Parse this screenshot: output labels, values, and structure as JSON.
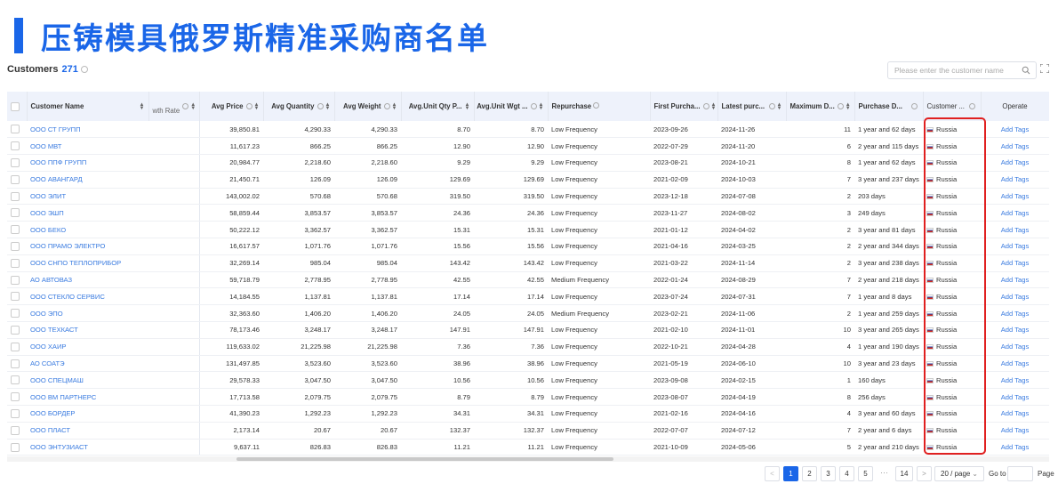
{
  "banner": {
    "title": "压铸模具俄罗斯精准采购商名单"
  },
  "customers": {
    "label": "Customers",
    "count": "271"
  },
  "search": {
    "placeholder": "Please enter the customer name"
  },
  "columns": {
    "name": "Customer Name",
    "growth": "wth Rate",
    "avg_price": "Avg Price",
    "avg_qty": "Avg Quantity",
    "avg_weight": "Avg Weight",
    "unit_qty": "Avg.Unit Qty P...",
    "unit_wgt": "Avg.Unit Wgt ...",
    "repurchase": "Repurchase",
    "first": "First Purcha...",
    "latest": "Latest purc...",
    "max": "Maximum D...",
    "duration": "Purchase D...",
    "country": "Customer ...",
    "operate": "Operate"
  },
  "rows": [
    {
      "name": "ООО СТ ГРУПП",
      "price": "39,850.81",
      "qty": "4,290.33",
      "weight": "4,290.33",
      "uqty": "8.70",
      "uwgt": "8.70",
      "rep": "Low Frequency",
      "first": "2023-09-26",
      "latest": "2024-11-26",
      "max": "11",
      "dur": "1 year and 62 days",
      "country": "Russia",
      "op": "Add Tags"
    },
    {
      "name": "ООО МВТ",
      "price": "11,617.23",
      "qty": "866.25",
      "weight": "866.25",
      "uqty": "12.90",
      "uwgt": "12.90",
      "rep": "Low Frequency",
      "first": "2022-07-29",
      "latest": "2024-11-20",
      "max": "6",
      "dur": "2 year and 115 days",
      "country": "Russia",
      "op": "Add Tags"
    },
    {
      "name": "ООО ППФ ГРУПП",
      "price": "20,984.77",
      "qty": "2,218.60",
      "weight": "2,218.60",
      "uqty": "9.29",
      "uwgt": "9.29",
      "rep": "Low Frequency",
      "first": "2023-08-21",
      "latest": "2024-10-21",
      "max": "8",
      "dur": "1 year and 62 days",
      "country": "Russia",
      "op": "Add Tags"
    },
    {
      "name": "ООО АВАНГАРД",
      "price": "21,450.71",
      "qty": "126.09",
      "weight": "126.09",
      "uqty": "129.69",
      "uwgt": "129.69",
      "rep": "Low Frequency",
      "first": "2021-02-09",
      "latest": "2024-10-03",
      "max": "7",
      "dur": "3 year and 237 days",
      "country": "Russia",
      "op": "Add Tags"
    },
    {
      "name": "ООО ЭЛИТ",
      "price": "143,002.02",
      "qty": "570.68",
      "weight": "570.68",
      "uqty": "319.50",
      "uwgt": "319.50",
      "rep": "Low Frequency",
      "first": "2023-12-18",
      "latest": "2024-07-08",
      "max": "2",
      "dur": "203 days",
      "country": "Russia",
      "op": "Add Tags"
    },
    {
      "name": "ООО ЭШП",
      "price": "58,859.44",
      "qty": "3,853.57",
      "weight": "3,853.57",
      "uqty": "24.36",
      "uwgt": "24.36",
      "rep": "Low Frequency",
      "first": "2023-11-27",
      "latest": "2024-08-02",
      "max": "3",
      "dur": "249 days",
      "country": "Russia",
      "op": "Add Tags"
    },
    {
      "name": "ООО БЕКО",
      "price": "50,222.12",
      "qty": "3,362.57",
      "weight": "3,362.57",
      "uqty": "15.31",
      "uwgt": "15.31",
      "rep": "Low Frequency",
      "first": "2021-01-12",
      "latest": "2024-04-02",
      "max": "2",
      "dur": "3 year and 81 days",
      "country": "Russia",
      "op": "Add Tags"
    },
    {
      "name": "ООО ПРАМО ЭЛЕКТРО",
      "price": "16,617.57",
      "qty": "1,071.76",
      "weight": "1,071.76",
      "uqty": "15.56",
      "uwgt": "15.56",
      "rep": "Low Frequency",
      "first": "2021-04-16",
      "latest": "2024-03-25",
      "max": "2",
      "dur": "2 year and 344 days",
      "country": "Russia",
      "op": "Add Tags"
    },
    {
      "name": "ООО СНПО ТЕПЛОПРИБОР",
      "price": "32,269.14",
      "qty": "985.04",
      "weight": "985.04",
      "uqty": "143.42",
      "uwgt": "143.42",
      "rep": "Low Frequency",
      "first": "2021-03-22",
      "latest": "2024-11-14",
      "max": "2",
      "dur": "3 year and 238 days",
      "country": "Russia",
      "op": "Add Tags"
    },
    {
      "name": "АО АВТОВАЗ",
      "price": "59,718.79",
      "qty": "2,778.95",
      "weight": "2,778.95",
      "uqty": "42.55",
      "uwgt": "42.55",
      "rep": "Medium Frequency",
      "first": "2022-01-24",
      "latest": "2024-08-29",
      "max": "7",
      "dur": "2 year and 218 days",
      "country": "Russia",
      "op": "Add Tags"
    },
    {
      "name": "ООО СТЕКЛО СЕРВИС",
      "price": "14,184.55",
      "qty": "1,137.81",
      "weight": "1,137.81",
      "uqty": "17.14",
      "uwgt": "17.14",
      "rep": "Low Frequency",
      "first": "2023-07-24",
      "latest": "2024-07-31",
      "max": "7",
      "dur": "1 year and 8 days",
      "country": "Russia",
      "op": "Add Tags"
    },
    {
      "name": "ООО ЭПО",
      "price": "32,363.60",
      "qty": "1,406.20",
      "weight": "1,406.20",
      "uqty": "24.05",
      "uwgt": "24.05",
      "rep": "Medium Frequency",
      "first": "2023-02-21",
      "latest": "2024-11-06",
      "max": "2",
      "dur": "1 year and 259 days",
      "country": "Russia",
      "op": "Add Tags"
    },
    {
      "name": "ООО ТЕХКАСТ",
      "price": "78,173.46",
      "qty": "3,248.17",
      "weight": "3,248.17",
      "uqty": "147.91",
      "uwgt": "147.91",
      "rep": "Low Frequency",
      "first": "2021-02-10",
      "latest": "2024-11-01",
      "max": "10",
      "dur": "3 year and 265 days",
      "country": "Russia",
      "op": "Add Tags"
    },
    {
      "name": "ООО ХАИР",
      "price": "119,633.02",
      "qty": "21,225.98",
      "weight": "21,225.98",
      "uqty": "7.36",
      "uwgt": "7.36",
      "rep": "Low Frequency",
      "first": "2022-10-21",
      "latest": "2024-04-28",
      "max": "4",
      "dur": "1 year and 190 days",
      "country": "Russia",
      "op": "Add Tags"
    },
    {
      "name": "АО СОАТЭ",
      "price": "131,497.85",
      "qty": "3,523.60",
      "weight": "3,523.60",
      "uqty": "38.96",
      "uwgt": "38.96",
      "rep": "Low Frequency",
      "first": "2021-05-19",
      "latest": "2024-06-10",
      "max": "10",
      "dur": "3 year and 23 days",
      "country": "Russia",
      "op": "Add Tags"
    },
    {
      "name": "ООО СПЕЦМАШ",
      "price": "29,578.33",
      "qty": "3,047.50",
      "weight": "3,047.50",
      "uqty": "10.56",
      "uwgt": "10.56",
      "rep": "Low Frequency",
      "first": "2023-09-08",
      "latest": "2024-02-15",
      "max": "1",
      "dur": "160 days",
      "country": "Russia",
      "op": "Add Tags"
    },
    {
      "name": "ООО ВМ ПАРТНЕРС",
      "price": "17,713.58",
      "qty": "2,079.75",
      "weight": "2,079.75",
      "uqty": "8.79",
      "uwgt": "8.79",
      "rep": "Low Frequency",
      "first": "2023-08-07",
      "latest": "2024-04-19",
      "max": "8",
      "dur": "256 days",
      "country": "Russia",
      "op": "Add Tags"
    },
    {
      "name": "ООО БОРДЕР",
      "price": "41,390.23",
      "qty": "1,292.23",
      "weight": "1,292.23",
      "uqty": "34.31",
      "uwgt": "34.31",
      "rep": "Low Frequency",
      "first": "2021-02-16",
      "latest": "2024-04-16",
      "max": "4",
      "dur": "3 year and 60 days",
      "country": "Russia",
      "op": "Add Tags"
    },
    {
      "name": "ООО ПЛАСТ",
      "price": "2,173.14",
      "qty": "20.67",
      "weight": "20.67",
      "uqty": "132.37",
      "uwgt": "132.37",
      "rep": "Low Frequency",
      "first": "2022-07-07",
      "latest": "2024-07-12",
      "max": "7",
      "dur": "2 year and 6 days",
      "country": "Russia",
      "op": "Add Tags"
    },
    {
      "name": "ООО ЭНТУЗИАСТ",
      "price": "9,637.11",
      "qty": "826.83",
      "weight": "826.83",
      "uqty": "11.21",
      "uwgt": "11.21",
      "rep": "Low Frequency",
      "first": "2021-10-09",
      "latest": "2024-05-06",
      "max": "5",
      "dur": "2 year and 210 days",
      "country": "Russia",
      "op": "Add Tags"
    }
  ],
  "pagination": {
    "prev": "<",
    "pages": [
      "1",
      "2",
      "3",
      "4",
      "5"
    ],
    "ellipsis": "···",
    "last": "14",
    "next": ">",
    "page_size": "20 / page",
    "goto_label": "Go to",
    "page_label": "Page",
    "current": "1"
  },
  "colors": {
    "accent": "#1a66e8",
    "link": "#3a7be0",
    "highlight": "#e02020",
    "header_bg": "#eef2fb"
  }
}
